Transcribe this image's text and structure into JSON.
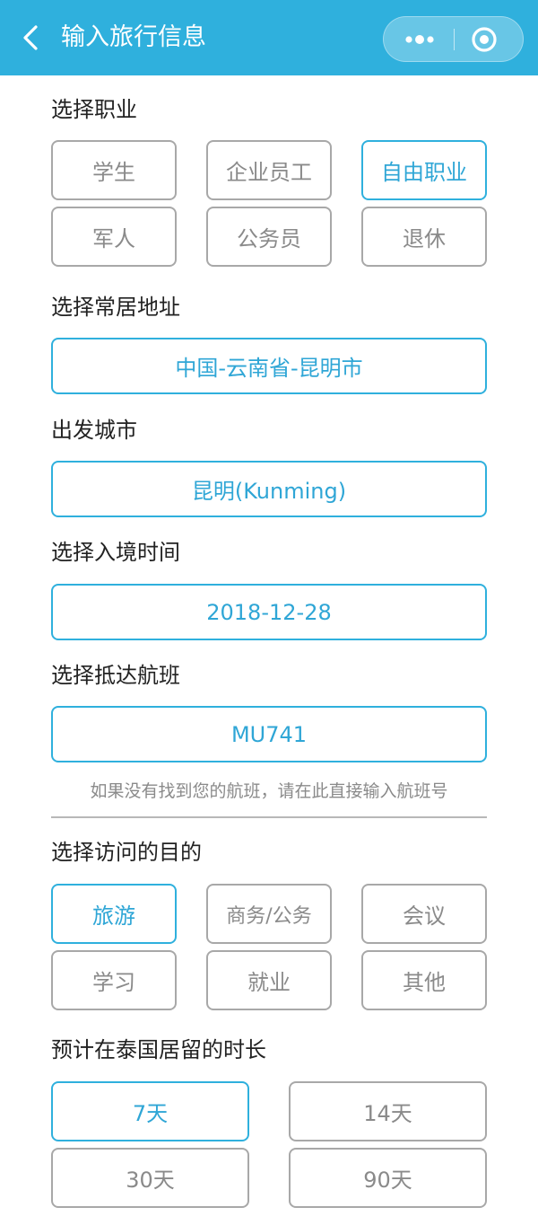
{
  "header": {
    "title": "输入旅行信息",
    "back_icon": "chevron-left-icon",
    "more_icon": "more-dots-icon",
    "close_icon": "target-close-icon"
  },
  "occupation": {
    "label": "选择职业",
    "options": [
      "学生",
      "企业员工",
      "自由职业",
      "军人",
      "公务员",
      "退休"
    ],
    "selected": "自由职业"
  },
  "residence": {
    "label": "选择常居地址",
    "value": "中国-云南省-昆明市"
  },
  "departure_city": {
    "label": "出发城市",
    "value": "昆明(Kunming)"
  },
  "entry_date": {
    "label": "选择入境时间",
    "value": "2018-12-28"
  },
  "flight": {
    "label": "选择抵达航班",
    "value": "MU741",
    "hint": "如果没有找到您的航班，请在此直接输入航班号"
  },
  "purpose": {
    "label": "选择访问的目的",
    "options": [
      "旅游",
      "商务/公务",
      "会议",
      "学习",
      "就业",
      "其他"
    ],
    "selected": "旅游"
  },
  "duration": {
    "label": "预计在泰国居留的时长",
    "options": [
      "7天",
      "14天",
      "30天",
      "90天"
    ],
    "selected": "7天"
  },
  "colors": {
    "accent": "#2fb0dd",
    "header_bg": "#2fb0dd",
    "border_gray": "#a8a8a8",
    "text_gray": "#8a8a8a"
  }
}
